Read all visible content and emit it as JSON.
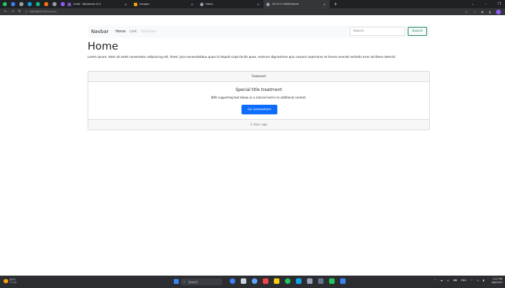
{
  "browser": {
    "tabs": [
      {
        "label": "Cards · Bootstrap v5.3",
        "favicon_color": "#7952b3",
        "active": false
      },
      {
        "label": "Laragon",
        "favicon_color": "#f59e0b",
        "active": false
      },
      {
        "label": "Home",
        "favicon_color": "#9aa0a6",
        "active": false
      },
      {
        "label": "127.0.0.1:8000/home",
        "favicon_color": "#9aa0a6",
        "active": true
      }
    ],
    "new_tab_glyph": "+",
    "address": {
      "host": "127.0.0.1",
      "path": ":8000/home"
    }
  },
  "navbar": {
    "brand": "Navbar",
    "links": [
      "Home",
      "Link",
      "Disabled"
    ],
    "search_placeholder": "Search",
    "search_button": "Search"
  },
  "page": {
    "heading": "Home",
    "lorem": "Lorem ipsum, dolor sit amet consectetur adipisicing elit. Amet, ipsa necessitatibus quasi id aliquid culpa facilis quae, nostrum dignissimos quis corporis asperiores et harum eveniet veritatis error ab libero deleniti."
  },
  "card": {
    "header": "Featured",
    "title": "Special title treatment",
    "text": "With supporting text below as a natural lead-in to additional content.",
    "button": "Go somewhere",
    "footer": "2 days ago"
  },
  "taskbar": {
    "weather_temp": "30°C",
    "weather_desc": "Cerah",
    "search_label": "Search",
    "lang": "ENG",
    "time": "2:57 PM",
    "date": "6/6/2023"
  },
  "colors": {
    "primary": "#0d6efd",
    "success": "#198754"
  }
}
